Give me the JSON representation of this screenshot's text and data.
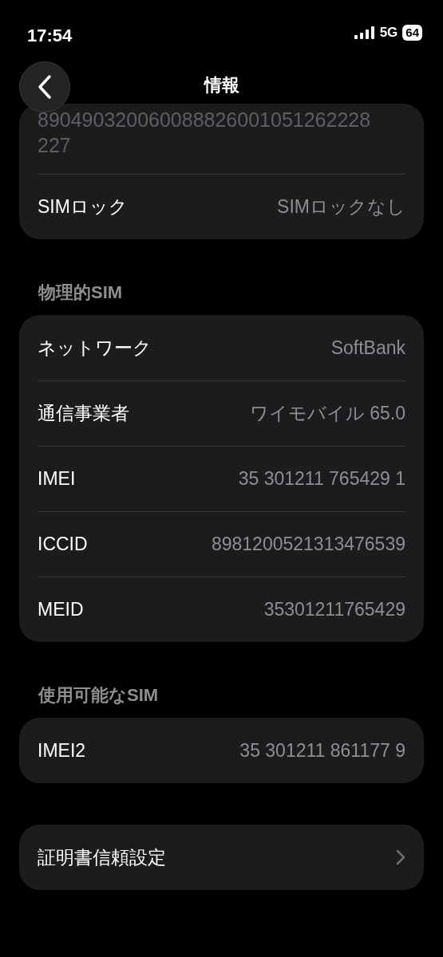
{
  "status_bar": {
    "time": "17:54",
    "network": "5G",
    "battery": "64"
  },
  "nav": {
    "title": "情報"
  },
  "groups": [
    {
      "rows": [
        {
          "kind": "value",
          "value": "890490320060088826001051262228227"
        },
        {
          "kind": "pair",
          "label": "SIMロック",
          "value": "SIMロックなし"
        }
      ]
    },
    {
      "header": "物理的SIM",
      "rows": [
        {
          "kind": "pair",
          "label": "ネットワーク",
          "value": "SoftBank"
        },
        {
          "kind": "pair",
          "label": "通信事業者",
          "value": "ワイモバイル 65.0"
        },
        {
          "kind": "pair",
          "label": "IMEI",
          "value": "35 301211 765429 1"
        },
        {
          "kind": "pair",
          "label": "ICCID",
          "value": "8981200521313476539"
        },
        {
          "kind": "pair",
          "label": "MEID",
          "value": "35301211765429"
        }
      ]
    },
    {
      "header": "使用可能なSIM",
      "rows": [
        {
          "kind": "pair",
          "label": "IMEI2",
          "value": "35 301211 861177 9"
        }
      ]
    },
    {
      "rows": [
        {
          "kind": "link",
          "label": "証明書信頼設定"
        }
      ]
    }
  ]
}
